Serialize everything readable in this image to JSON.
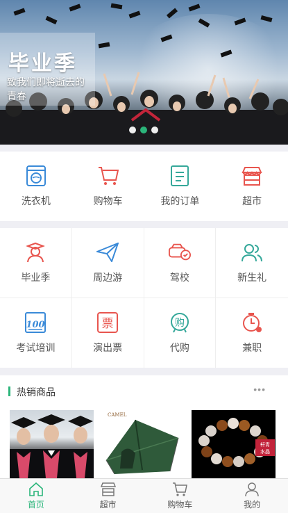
{
  "banner": {
    "title": "毕业季",
    "subtitle": "致我们即将逝去的青春",
    "slide_count": 3,
    "active_slide": 2
  },
  "quick_menu": [
    {
      "label": "洗衣机",
      "icon": "washing-machine-icon"
    },
    {
      "label": "购物车",
      "icon": "cart-icon"
    },
    {
      "label": "我的订单",
      "icon": "order-icon"
    },
    {
      "label": "超市",
      "icon": "store-icon"
    }
  ],
  "services": [
    {
      "label": "毕业季",
      "icon": "graduate-icon"
    },
    {
      "label": "周边游",
      "icon": "paper-plane-icon"
    },
    {
      "label": "驾校",
      "icon": "car-check-icon"
    },
    {
      "label": "新生礼",
      "icon": "people-icon"
    },
    {
      "label": "考试培训",
      "icon": "exam-icon"
    },
    {
      "label": "演出票",
      "icon": "ticket-icon"
    },
    {
      "label": "代购",
      "icon": "purchase-icon"
    },
    {
      "label": "兼职",
      "icon": "clock-icon"
    }
  ],
  "hot": {
    "title": "热销商品",
    "more": "•••",
    "products": [
      {
        "name": "graduation-photo"
      },
      {
        "name": "camel-tent",
        "brand": "CAMEL"
      },
      {
        "name": "crystal-bracelet",
        "tag": "轩青水晶"
      }
    ]
  },
  "tabs": [
    {
      "label": "首页",
      "icon": "home-icon",
      "active": true
    },
    {
      "label": "超市",
      "icon": "store-icon",
      "active": false
    },
    {
      "label": "购物车",
      "icon": "cart-icon",
      "active": false
    },
    {
      "label": "我的",
      "icon": "user-icon",
      "active": false
    }
  ],
  "colors": {
    "accent": "#2bb57a",
    "red": "#e8554e",
    "blue": "#3a8ad8",
    "teal": "#35a89a"
  }
}
